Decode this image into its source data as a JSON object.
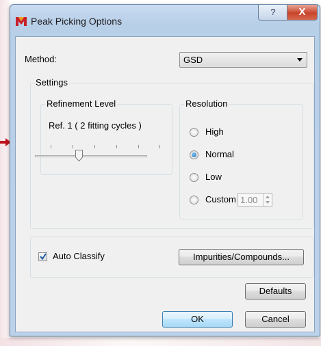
{
  "window": {
    "title": "Peak Picking Options",
    "help_label": "?",
    "close_label": "X"
  },
  "method": {
    "label": "Method:",
    "selected": "GSD"
  },
  "settings": {
    "label": "Settings",
    "refinement": {
      "label": "Refinement Level",
      "value_text": "Ref. 1 ( 2 fitting cycles )",
      "level": 2,
      "tick_count": 6
    },
    "resolution": {
      "label": "Resolution",
      "options": [
        "High",
        "Normal",
        "Low",
        "Custom"
      ],
      "selected": "Normal",
      "custom_value": "1.00"
    }
  },
  "auto_classify": {
    "label": "Auto Classify",
    "checked": true
  },
  "buttons": {
    "impurities": "Impurities/Compounds...",
    "defaults": "Defaults",
    "ok": "OK",
    "cancel": "Cancel"
  },
  "colors": {
    "accent": "#1e6fb6",
    "close_button": "#c8452b",
    "annotation_arrow": "#c0151c"
  }
}
